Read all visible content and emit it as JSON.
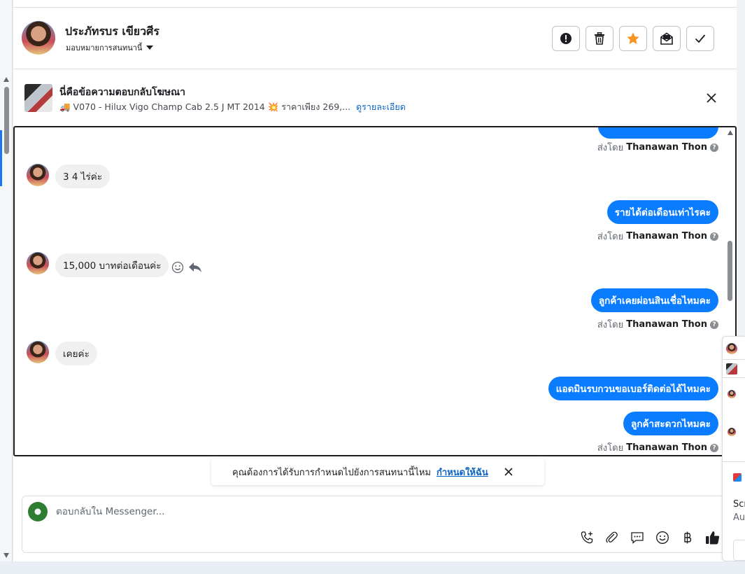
{
  "header": {
    "contact_name": "ประภัทรบร เขียวศีร",
    "assign_label": "มอบหมายการสนทนานี้"
  },
  "ad": {
    "title": "นี่คือข้อความตอบกลับโฆษณา",
    "subtitle": "🚚 V070 - Hilux Vigo Champ Cab 2.5 J MT 2014 💥 ราคาเพียง 269,...",
    "details_link": "ดูรายละเอียด"
  },
  "messages": [
    {
      "type": "sentby",
      "prefix": "ส่งโดย",
      "agent": "Thanawan Thon"
    },
    {
      "type": "in",
      "text": "3 4 ไร่ค่ะ"
    },
    {
      "type": "out",
      "text": "รายได้ต่อเดือนเท่าไรคะ"
    },
    {
      "type": "sentby",
      "prefix": "ส่งโดย",
      "agent": "Thanawan Thon"
    },
    {
      "type": "in",
      "text": "15,000 บาทต่อเดือนค่ะ"
    },
    {
      "type": "out",
      "text": "ลูกค้าเคยผ่อนสินเชื่อไหมคะ"
    },
    {
      "type": "sentby",
      "prefix": "ส่งโดย",
      "agent": "Thanawan Thon"
    },
    {
      "type": "in",
      "text": "เคยค่ะ"
    },
    {
      "type": "out",
      "text": "แอดมินรบกวนขอเบอร์ติดต่อได้ไหมคะ"
    },
    {
      "type": "out",
      "text": "ลูกค้าสะดวกไหมคะ"
    },
    {
      "type": "sentby",
      "prefix": "ส่งโดย",
      "agent": "Thanawan Thon"
    }
  ],
  "notice": {
    "text": "คุณต้องการได้รับการกำหนดไปยังการสนทนานี้ไหม",
    "link": "กำหนดให้ฉัน"
  },
  "composer": {
    "placeholder": "ตอบกลับใน Messenger..."
  },
  "overlay": {
    "text1": "Scr",
    "text2": "Au"
  },
  "colors": {
    "accent": "#0a7cff",
    "link": "#0a66c2",
    "star": "#f7931e"
  }
}
